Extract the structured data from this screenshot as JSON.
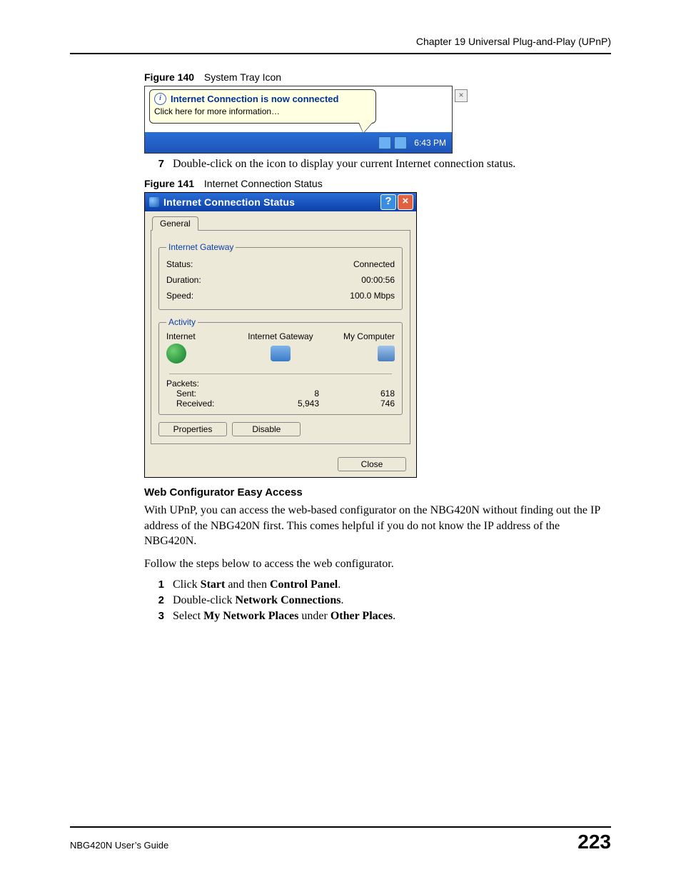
{
  "header": {
    "chapter": "Chapter 19 Universal Plug-and-Play (UPnP)"
  },
  "fig140": {
    "caption_num": "Figure 140",
    "caption_title": "System Tray Icon",
    "balloon_title": "Internet Connection is now connected",
    "balloon_sub": "Click here for more information…",
    "close_glyph": "×",
    "tray_time": "6:43 PM"
  },
  "step7": {
    "num": "7",
    "text": "Double-click on the icon to display your current Internet connection status."
  },
  "fig141": {
    "caption_num": "Figure 141",
    "caption_title": "Internet Connection Status",
    "title": "Internet Connection Status",
    "help_glyph": "?",
    "close_glyph": "×",
    "tab": "General",
    "gateway_legend": "Internet Gateway",
    "status_label": "Status:",
    "status_value": "Connected",
    "duration_label": "Duration:",
    "duration_value": "00:00:56",
    "speed_label": "Speed:",
    "speed_value": "100.0 Mbps",
    "activity_legend": "Activity",
    "col_internet": "Internet",
    "col_gateway": "Internet Gateway",
    "col_mycomputer": "My Computer",
    "packets_label": "Packets:",
    "sent_label": "Sent:",
    "received_label": "Received:",
    "sent_gw": "8",
    "sent_pc": "618",
    "recv_gw": "5,943",
    "recv_pc": "746",
    "btn_properties": "Properties",
    "btn_disable": "Disable",
    "btn_close": "Close"
  },
  "body_text": {
    "heading": "Web Configurator Easy Access",
    "para1": "With UPnP, you can access the web-based configurator on the NBG420N without finding out the IP address of the NBG420N first. This comes helpful if you do not know the IP address of the NBG420N.",
    "para2": "Follow the steps below to access the web configurator.",
    "steps": [
      {
        "num": "1",
        "pre": "Click ",
        "b1": "Start",
        "mid": " and then ",
        "b2": "Control Panel",
        "post": "."
      },
      {
        "num": "2",
        "pre": "Double-click ",
        "b1": "Network Connections",
        "mid": "",
        "b2": "",
        "post": "."
      },
      {
        "num": "3",
        "pre": "Select ",
        "b1": "My Network Places",
        "mid": " under ",
        "b2": "Other Places",
        "post": "."
      }
    ]
  },
  "footer": {
    "guide": "NBG420N User’s Guide",
    "page": "223"
  }
}
